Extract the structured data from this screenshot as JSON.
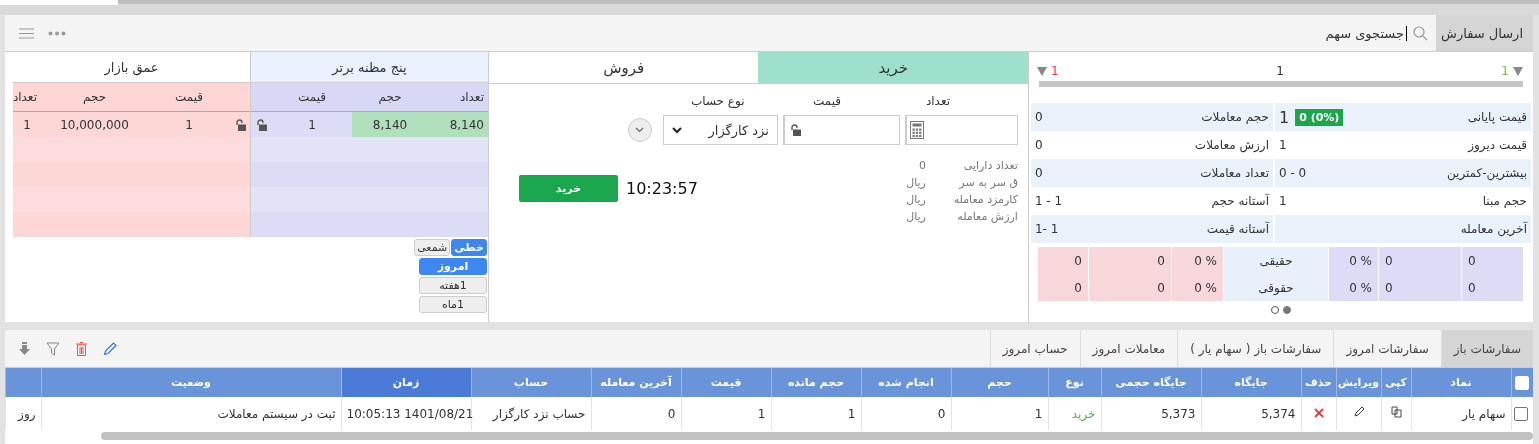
{
  "send_order": {
    "title": "ارسال سفارش",
    "search": {
      "placeholder": "جستجوی سهم"
    }
  },
  "ticker": {
    "high": "1",
    "mid": "1",
    "low": "1"
  },
  "stats": [
    {
      "cells": [
        {
          "label": "قیمت پایانی",
          "value": "1",
          "change": "0 (0%)"
        },
        {
          "label": "حجم معاملات",
          "value": "0"
        }
      ]
    },
    {
      "cells": [
        {
          "label": "قیمت دیروز",
          "value": "1"
        },
        {
          "label": "ارزش معاملات",
          "value": "0"
        }
      ]
    },
    {
      "cells": [
        {
          "label": "بیشترین-کمترین",
          "value": "0 - 0"
        },
        {
          "label": "تعداد معاملات",
          "value": "0"
        }
      ]
    },
    {
      "cells": [
        {
          "label": "حجم مبنا",
          "value": "1"
        },
        {
          "label": "آستانه حجم",
          "value": "1 - 1"
        }
      ]
    },
    {
      "cells": [
        {
          "label": "آخرین معامله"
        },
        {
          "label": "آستانه قیمت",
          "value": "1- 1"
        }
      ]
    }
  ],
  "holders": [
    {
      "label": "حقیقی",
      "buy": [
        "0",
        "0",
        "0 %"
      ],
      "sell": [
        "0 %",
        "0",
        "0"
      ]
    },
    {
      "label": "حقوقی",
      "buy": [
        "0",
        "0",
        "0 %"
      ],
      "sell": [
        "0 %",
        "0",
        "0"
      ]
    }
  ],
  "pager": [
    {
      "selected": true
    },
    {
      "selected": false
    }
  ],
  "trade_tabs": [
    {
      "label": "خرید",
      "selected": true
    },
    {
      "label": "فروش",
      "selected": false
    }
  ],
  "form": {
    "labels": [
      "تعداد",
      "قیمت",
      "نوع حساب"
    ],
    "account": "نزد کارگزار",
    "details": [
      {
        "label": "تعداد دارایی",
        "value": "0"
      },
      {
        "label": "ق سر به سر",
        "value": "ریال"
      },
      {
        "label": "کارمزد معامله",
        "value": "ریال"
      },
      {
        "label": "ارزش معامله",
        "value": "ریال"
      }
    ],
    "time": "10:23:57",
    "submit": "خرید"
  },
  "depth": {
    "bid_title": "پنج مظنه برتر",
    "ask_title": "عمق بازار",
    "bid_columns": [
      "تعداد",
      "حجم",
      "قیمت"
    ],
    "ask_columns": [
      "قیمت",
      "حجم",
      "تعداد"
    ],
    "rows": [
      {
        "bid_count": "8,140",
        "bid_volume": "8,140",
        "bid_price": "1",
        "ask_price": "1",
        "ask_volume": "10,000,000",
        "ask_count": "1"
      }
    ]
  },
  "chart_types": [
    {
      "label": "خطی",
      "selected": true
    },
    {
      "label": "شمعی",
      "selected": false
    }
  ],
  "periods": [
    {
      "label": "امروز",
      "selected": true
    },
    {
      "label": "1هفته",
      "selected": false
    },
    {
      "label": "1ماه",
      "selected": false
    }
  ],
  "orders": {
    "tabs": [
      {
        "label": "سفارشات باز",
        "selected": true
      },
      {
        "label": "سفارشات امروز",
        "selected": false
      },
      {
        "label": "سفارشات باز ( سهام یار )",
        "selected": false
      },
      {
        "label": "معاملات امروز",
        "selected": false
      },
      {
        "label": "حساب امروز",
        "selected": false
      }
    ],
    "all_checked": false,
    "columns": [
      {
        "label": "نماد",
        "sorted": false
      },
      {
        "label": "کپی",
        "sorted": false
      },
      {
        "label": "ویرایش",
        "sorted": false
      },
      {
        "label": "حذف",
        "sorted": false
      },
      {
        "label": "جایگاه",
        "sorted": false
      },
      {
        "label": "جایگاه حجمی",
        "sorted": false
      },
      {
        "label": "نوع",
        "sorted": false
      },
      {
        "label": "حجم",
        "sorted": false
      },
      {
        "label": "انجام شده",
        "sorted": false
      },
      {
        "label": "حجم مانده",
        "sorted": false
      },
      {
        "label": "قیمت",
        "sorted": false
      },
      {
        "label": "آخرین معامله",
        "sorted": false
      },
      {
        "label": "حساب",
        "sorted": false
      },
      {
        "label": "زمان",
        "sorted": true
      },
      {
        "label": "وضعیت",
        "sorted": false
      }
    ],
    "rows": [
      {
        "checked": false,
        "symbol": "سهام یار",
        "place": "5,374",
        "volume_place": "5,373",
        "side": {
          "text": "خرید",
          "kind": "buy"
        },
        "volume": "1",
        "done": "0",
        "remaining": "1",
        "price": "1",
        "last_trade": "0",
        "account": "حساب نزد کارگزار",
        "time": "10:05:13 1401/08/21",
        "status": "ثبت در سیستم معاملات",
        "column_17": "روز"
      }
    ]
  }
}
